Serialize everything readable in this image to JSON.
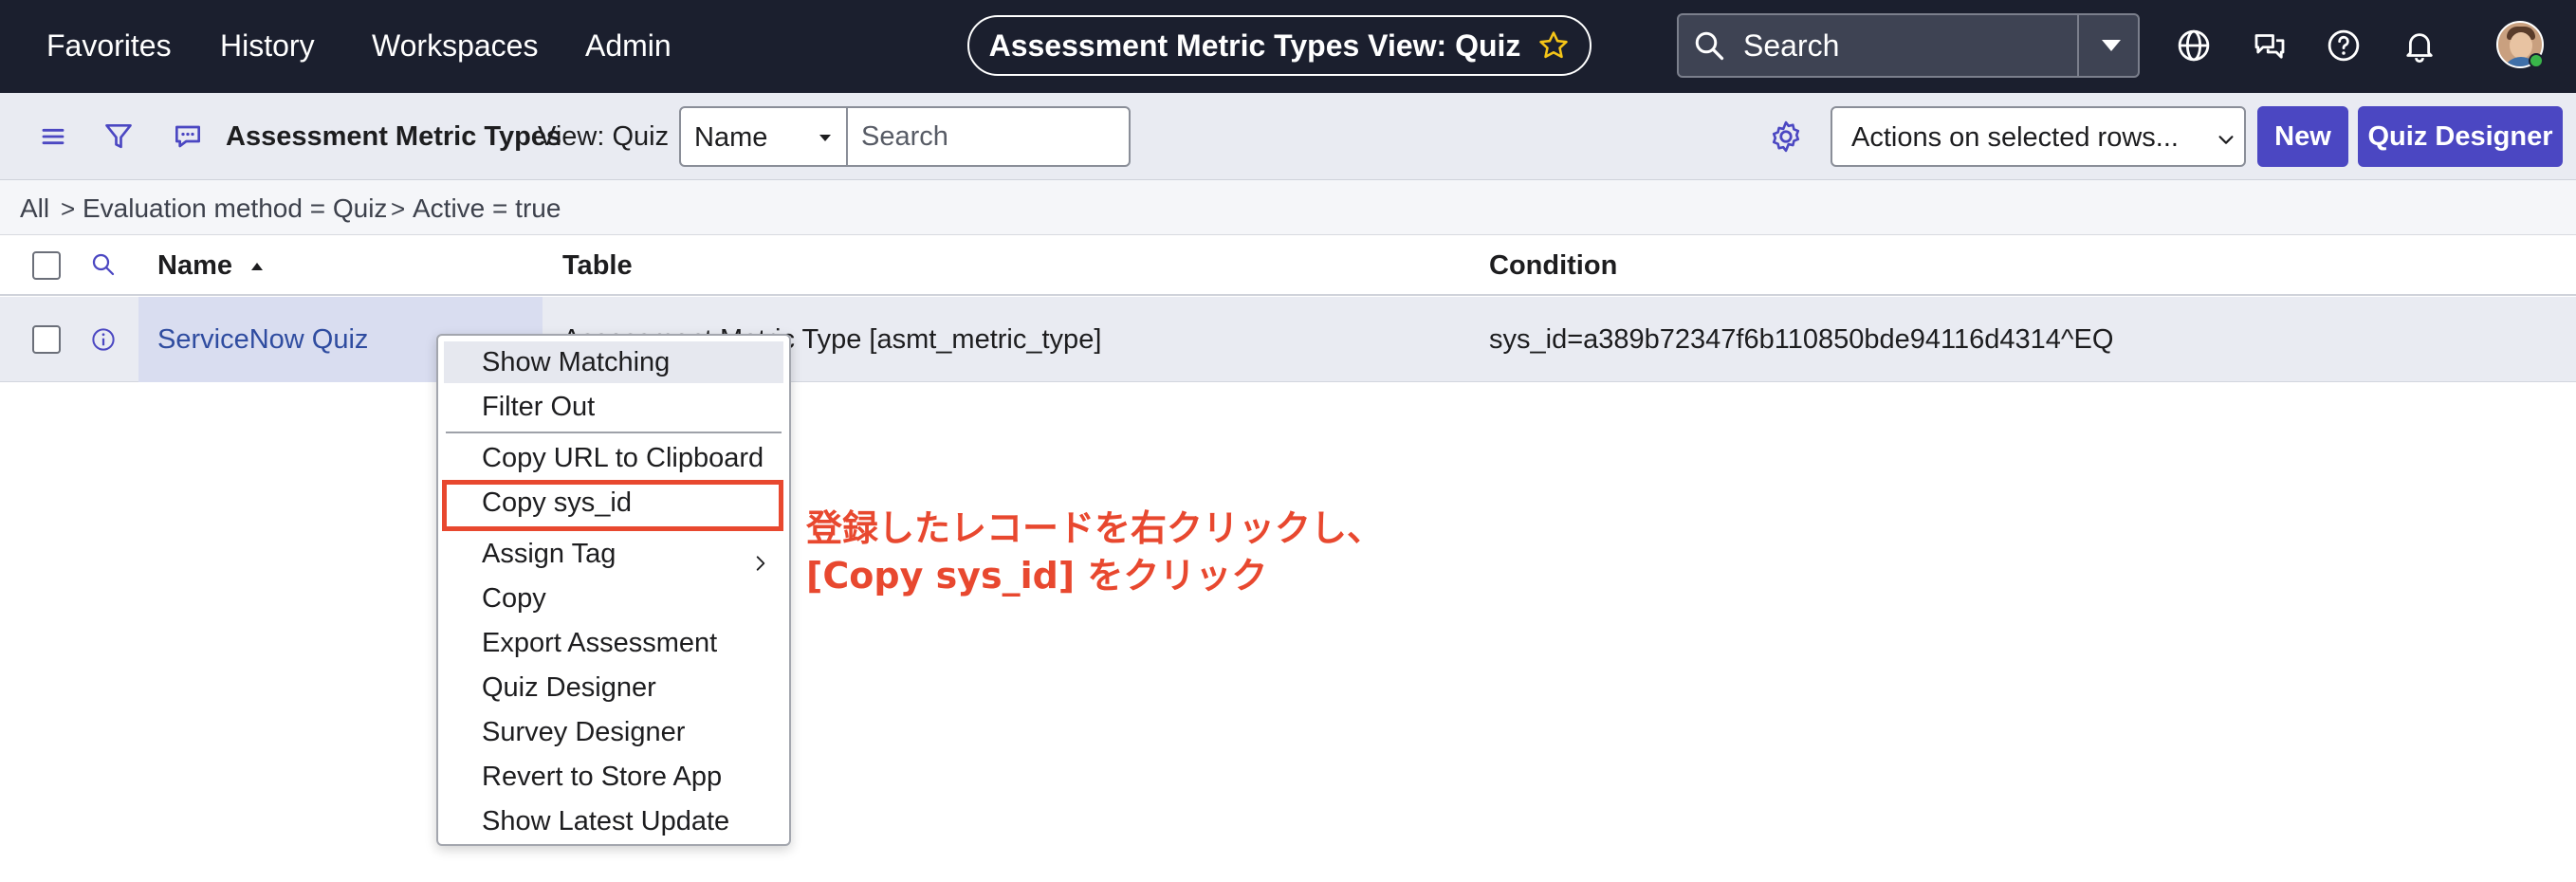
{
  "topnav": {
    "links": [
      "Favorites",
      "History",
      "Workspaces",
      "Admin"
    ],
    "title": "Assessment Metric Types View: Quiz",
    "search_placeholder": "Search",
    "icons": [
      "globe-icon",
      "chat-icon",
      "help-icon",
      "bell-icon"
    ]
  },
  "listbar": {
    "title": "Assessment Metric Types",
    "view": "View: Quiz",
    "field": "Name",
    "search_placeholder": "Search",
    "actions": "Actions on selected rows...",
    "new_label": "New",
    "quiz_designer_label": "Quiz Designer",
    "accent_color": "#4b47c2"
  },
  "breadcrumb": [
    "All",
    "Evaluation method = Quiz",
    "Active = true"
  ],
  "table": {
    "columns": [
      "Name",
      "Table",
      "Condition"
    ],
    "rows": [
      {
        "name": "ServiceNow Quiz",
        "table": "Assessment Metric Type [asmt_metric_type]",
        "condition": "sys_id=a389b72347f6b110850bde94116d4314^EQ"
      }
    ]
  },
  "context_menu": {
    "items": [
      "Show Matching",
      "Filter Out",
      "Copy URL to Clipboard",
      "Copy sys_id",
      "Assign Tag",
      "Copy",
      "Export Assessment",
      "Quiz Designer",
      "Survey Designer",
      "Revert to Store App",
      "Show Latest Update"
    ],
    "highlighted": "Copy sys_id"
  },
  "annotation": {
    "line1": "登録したレコードを右クリックし、",
    "line2": "[Copy sys_id] をクリック",
    "color": "#e8482f"
  }
}
